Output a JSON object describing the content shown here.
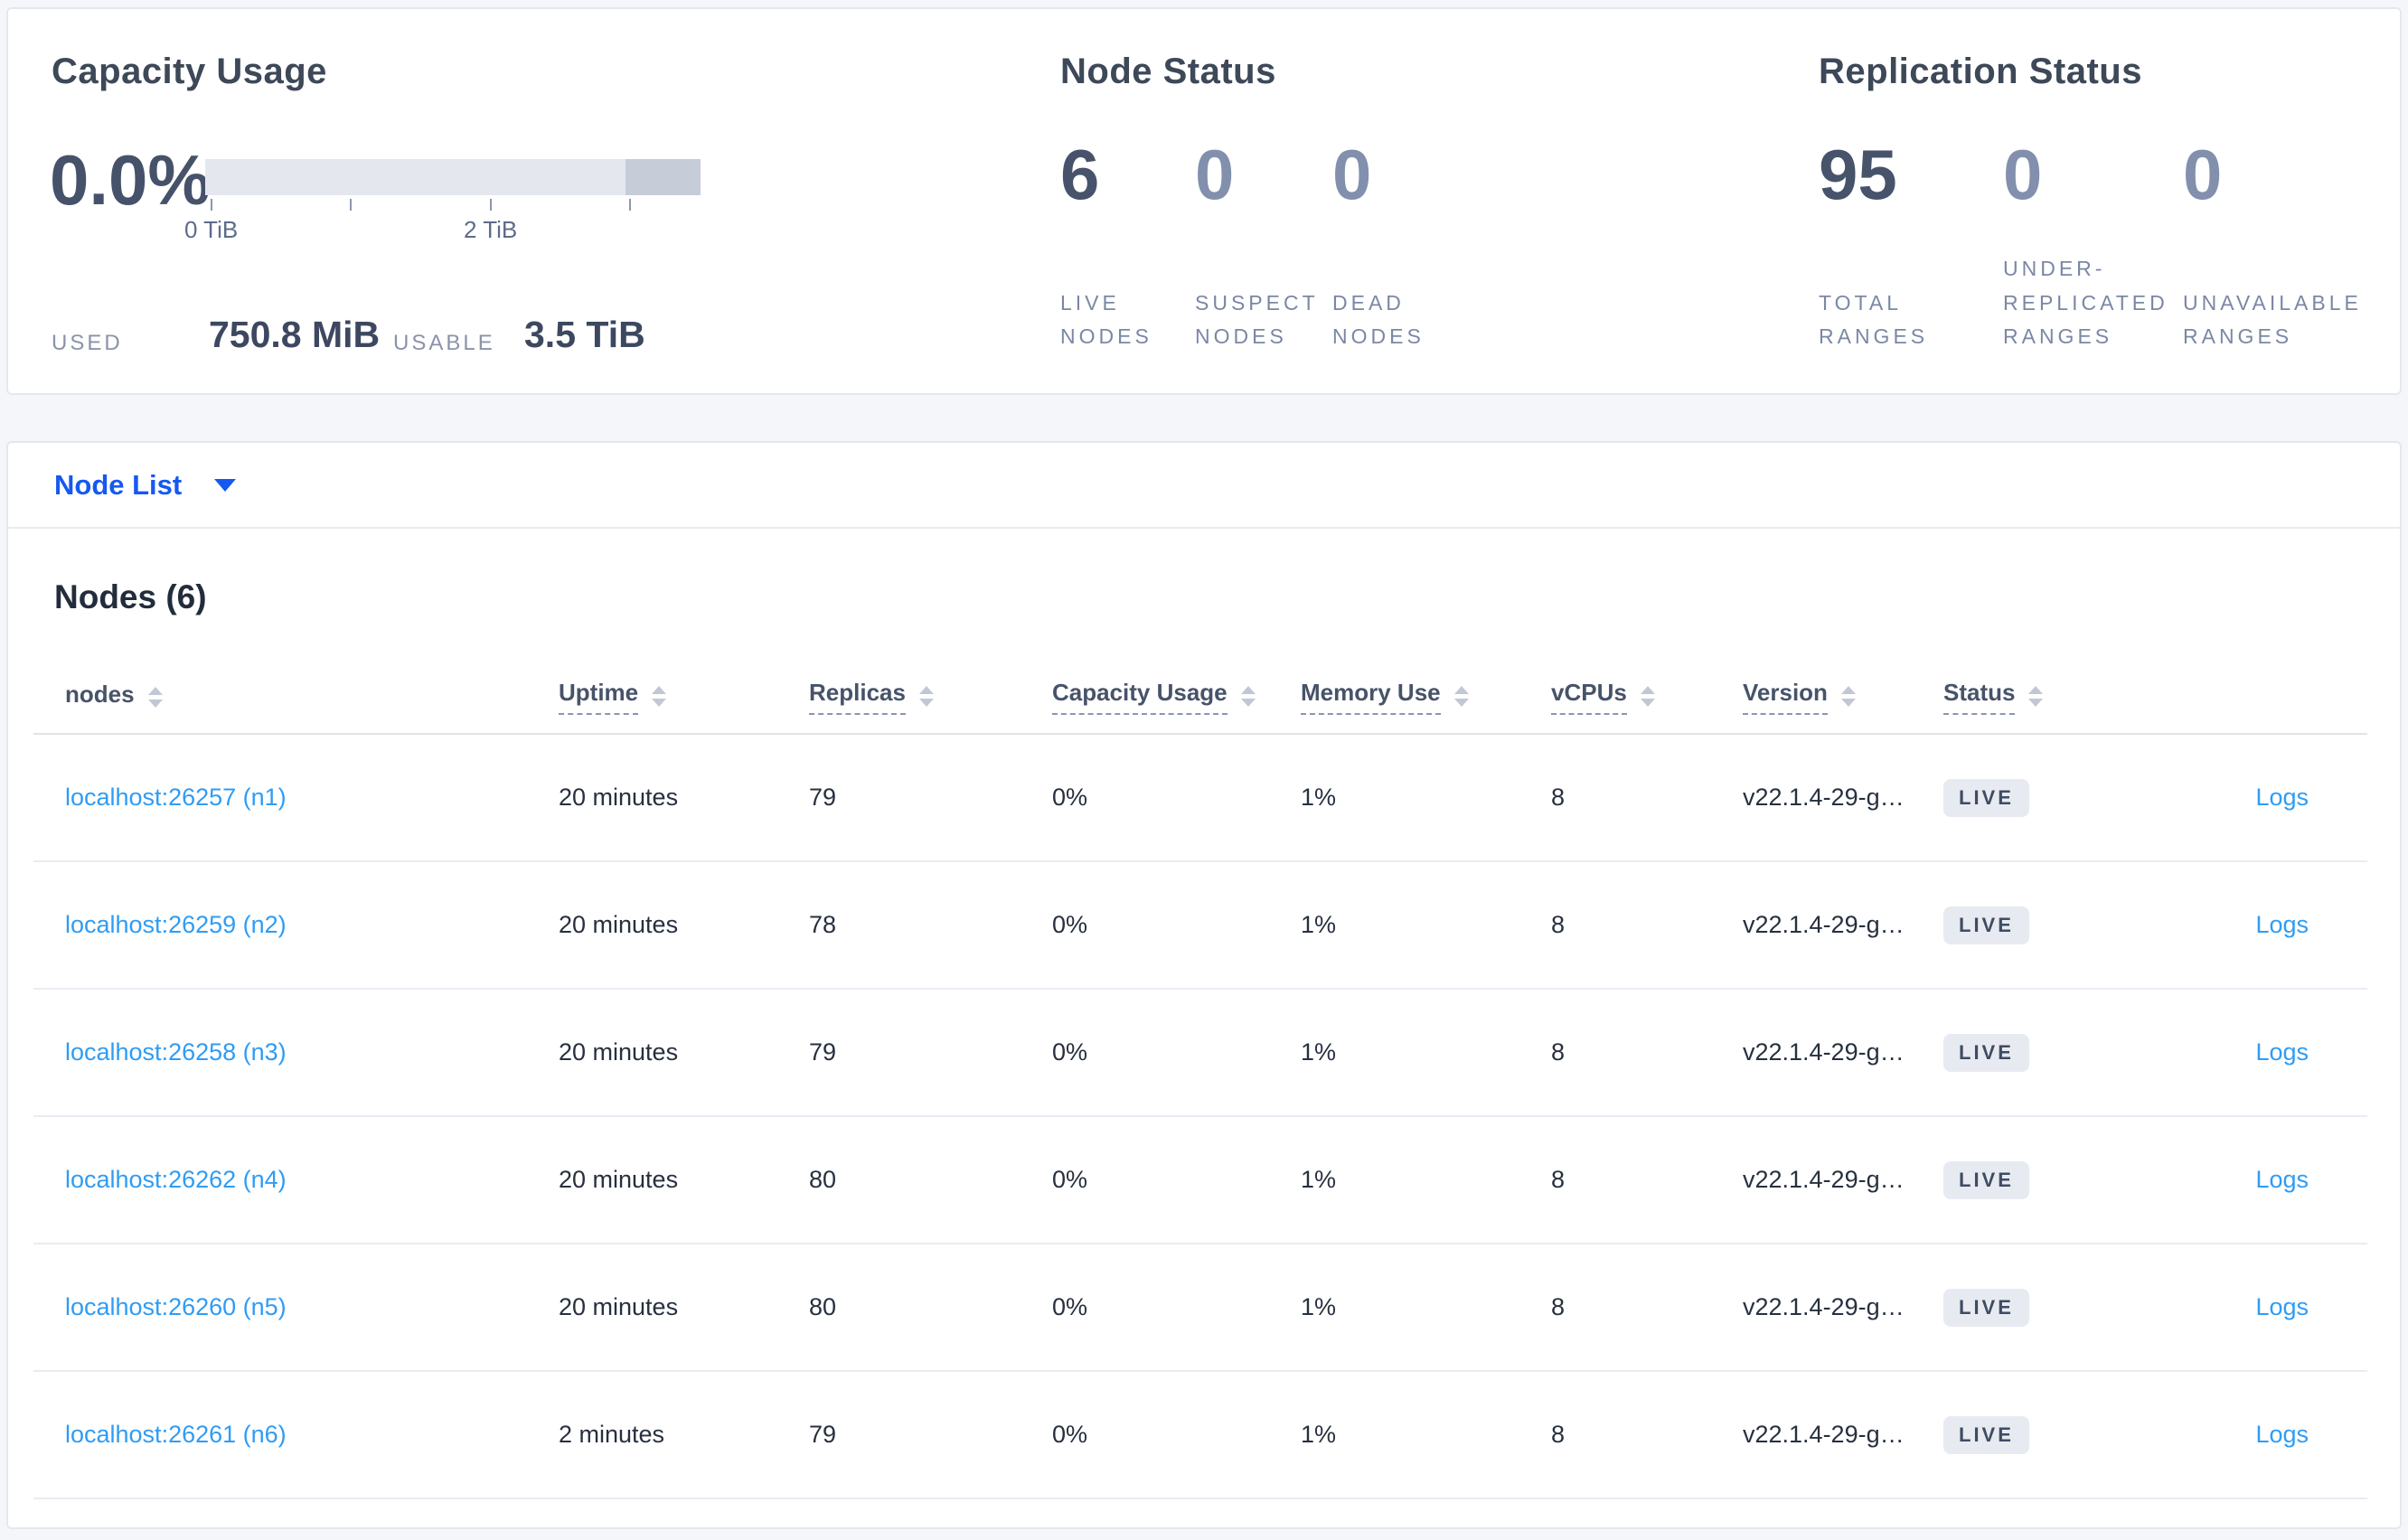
{
  "summary": {
    "capacity": {
      "title": "Capacity Usage",
      "percent": "0.0%",
      "bar": {
        "dark_start_pct": 84.8,
        "track_color": "#e4e7ee",
        "dark_color": "#c7ccd9",
        "ticks": [
          {
            "pos_pct": 1.2,
            "label": "0 TiB"
          },
          {
            "pos_pct": 29.4,
            "label": ""
          },
          {
            "pos_pct": 57.6,
            "label": "2 TiB"
          },
          {
            "pos_pct": 85.8,
            "label": ""
          }
        ]
      },
      "used_label": "USED",
      "used_value": "750.8 MiB",
      "usable_label": "USABLE",
      "usable_value": "3.5 TiB"
    },
    "node_status": {
      "title": "Node Status",
      "stats": [
        {
          "value": "6",
          "label": "LIVE NODES"
        },
        {
          "value": "0",
          "label": "SUSPECT NODES"
        },
        {
          "value": "0",
          "label": "DEAD NODES"
        }
      ]
    },
    "replication": {
      "title": "Replication Status",
      "stats": [
        {
          "value": "95",
          "label": "TOTAL RANGES"
        },
        {
          "value": "0",
          "label": "UNDER-REPLICATED RANGES"
        },
        {
          "value": "0",
          "label": "UNAVAILABLE RANGES"
        }
      ]
    }
  },
  "node_list": {
    "dropdown_label": "Node List",
    "heading": "Nodes (6)",
    "columns": [
      "nodes",
      "Uptime",
      "Replicas",
      "Capacity Usage",
      "Memory Use",
      "vCPUs",
      "Version",
      "Status"
    ],
    "rows": [
      {
        "node": "localhost:26257 (n1)",
        "uptime": "20 minutes",
        "replicas": "79",
        "capacity": "0%",
        "memory": "1%",
        "vcpus": "8",
        "version": "v22.1.4-29-g…",
        "status": "LIVE",
        "logs": "Logs"
      },
      {
        "node": "localhost:26259 (n2)",
        "uptime": "20 minutes",
        "replicas": "78",
        "capacity": "0%",
        "memory": "1%",
        "vcpus": "8",
        "version": "v22.1.4-29-g…",
        "status": "LIVE",
        "logs": "Logs"
      },
      {
        "node": "localhost:26258 (n3)",
        "uptime": "20 minutes",
        "replicas": "79",
        "capacity": "0%",
        "memory": "1%",
        "vcpus": "8",
        "version": "v22.1.4-29-g…",
        "status": "LIVE",
        "logs": "Logs"
      },
      {
        "node": "localhost:26262 (n4)",
        "uptime": "20 minutes",
        "replicas": "80",
        "capacity": "0%",
        "memory": "1%",
        "vcpus": "8",
        "version": "v22.1.4-29-g…",
        "status": "LIVE",
        "logs": "Logs"
      },
      {
        "node": "localhost:26260 (n5)",
        "uptime": "20 minutes",
        "replicas": "80",
        "capacity": "0%",
        "memory": "1%",
        "vcpus": "8",
        "version": "v22.1.4-29-g…",
        "status": "LIVE",
        "logs": "Logs"
      },
      {
        "node": "localhost:26261 (n6)",
        "uptime": "2 minutes",
        "replicas": "79",
        "capacity": "0%",
        "memory": "1%",
        "vcpus": "8",
        "version": "v22.1.4-29-g…",
        "status": "LIVE",
        "logs": "Logs"
      }
    ]
  },
  "colors": {
    "page_background": "#f4f6fa",
    "card_background": "#ffffff",
    "primary_blue": "#1559f1",
    "link_blue": "#2f9cf4",
    "dark_text": "#3d4858",
    "muted_stat": "#8290ae",
    "badge_background": "#e7ebf1"
  }
}
